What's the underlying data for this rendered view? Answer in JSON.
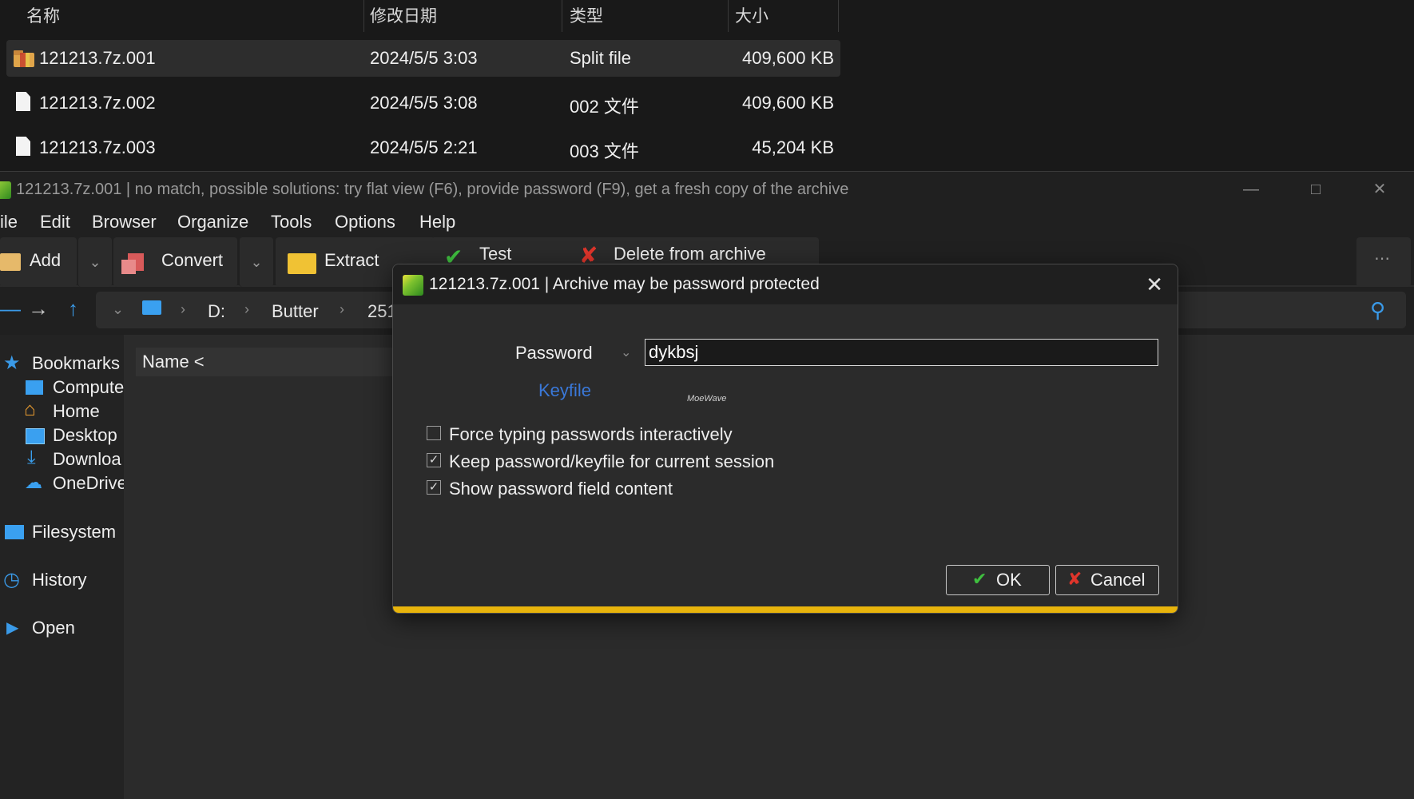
{
  "explorer": {
    "columns": {
      "name": "名称",
      "modified": "修改日期",
      "type": "类型",
      "size": "大小"
    },
    "files": [
      {
        "name": "121213.7z.001",
        "modified": "2024/5/5 3:03",
        "type": "Split file",
        "size": "409,600 KB",
        "icon": "archive-split-icon"
      },
      {
        "name": "121213.7z.002",
        "modified": "2024/5/5 3:08",
        "type": "002 文件",
        "size": "409,600 KB",
        "icon": "document-icon"
      },
      {
        "name": "121213.7z.003",
        "modified": "2024/5/5 2:21",
        "type": "003 文件",
        "size": "45,204 KB",
        "icon": "document-icon"
      }
    ]
  },
  "window": {
    "title": "121213.7z.001 | no match, possible solutions: try flat view (F6), provide password (F9), get a fresh copy of the archive",
    "menu": [
      "ile",
      "Edit",
      "Browser",
      "Organize",
      "Tools",
      "Options",
      "Help"
    ],
    "toolbar": {
      "add": "Add",
      "convert": "Convert",
      "extract": "Extract",
      "test": "Test",
      "delete": "Delete from archive"
    },
    "breadcrumb": {
      "drive": "D:",
      "folder": "Butter",
      "partial": "251"
    },
    "column_name": "Name <",
    "sidebar": {
      "bookmarks": "Bookmarks",
      "items": [
        "Compute",
        "Home",
        "Desktop",
        "Downloa",
        "OneDrive"
      ],
      "filesystem": "Filesystem",
      "history": "History",
      "open": "Open"
    }
  },
  "dialog": {
    "title": "121213.7z.001 | Archive may be password protected",
    "password_label": "Password",
    "password_value": "dykbsj",
    "keyfile_label": "Keyfile",
    "watermark": "MoeWave",
    "options": [
      {
        "label": "Force typing passwords interactively",
        "checked": ""
      },
      {
        "label": "Keep password/keyfile for current session",
        "checked": "✓"
      },
      {
        "label": "Show password field content",
        "checked": "✓"
      }
    ],
    "ok_label": "OK",
    "cancel_label": "Cancel",
    "colors": {
      "accent_bar": "#e8b40c",
      "link": "#3a78d8",
      "ok_icon": "#3fbf3f",
      "cancel_icon": "#e0352b"
    }
  }
}
